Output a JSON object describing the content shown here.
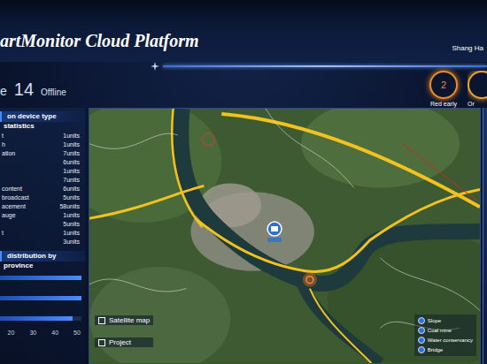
{
  "header": {
    "title": "artMonitor Cloud Platform",
    "location": "Shang Ha"
  },
  "summary": {
    "online_label": "e",
    "offline_count": "14",
    "offline_label": "Offline"
  },
  "alerts": [
    {
      "value": "2",
      "label": "Red early",
      "color": "#f08a24"
    },
    {
      "value": "",
      "label": "Or",
      "color": "#e8a030"
    }
  ],
  "device_panel": {
    "title": "on device type",
    "subtitle": "statistics",
    "items": [
      {
        "name": "t",
        "count": "1units"
      },
      {
        "name": "h",
        "count": "1units"
      },
      {
        "name": "ation",
        "count": "7units"
      },
      {
        "name": "",
        "count": "6units"
      },
      {
        "name": "",
        "count": "1units"
      },
      {
        "name": "",
        "count": "7units"
      },
      {
        "name": "content",
        "count": "6units"
      },
      {
        "name": "broadcast",
        "count": "5units"
      },
      {
        "name": "acement",
        "count": "58units"
      },
      {
        "name": "auge",
        "count": "1units"
      },
      {
        "name": "",
        "count": "5units"
      },
      {
        "name": "t",
        "count": "1units"
      },
      {
        "name": "",
        "count": "3units"
      }
    ]
  },
  "province_panel": {
    "title": "distribution by",
    "subtitle": "province",
    "bars": [
      52,
      52,
      48
    ],
    "ticks": [
      "20",
      "30",
      "40",
      "50"
    ]
  },
  "map": {
    "controls": [
      {
        "label": "Satellite map"
      },
      {
        "label": "Project"
      }
    ],
    "legend": [
      {
        "label": "Slope"
      },
      {
        "label": "Coal mine"
      },
      {
        "label": "Water conservancy"
      },
      {
        "label": "Bridge"
      }
    ]
  }
}
